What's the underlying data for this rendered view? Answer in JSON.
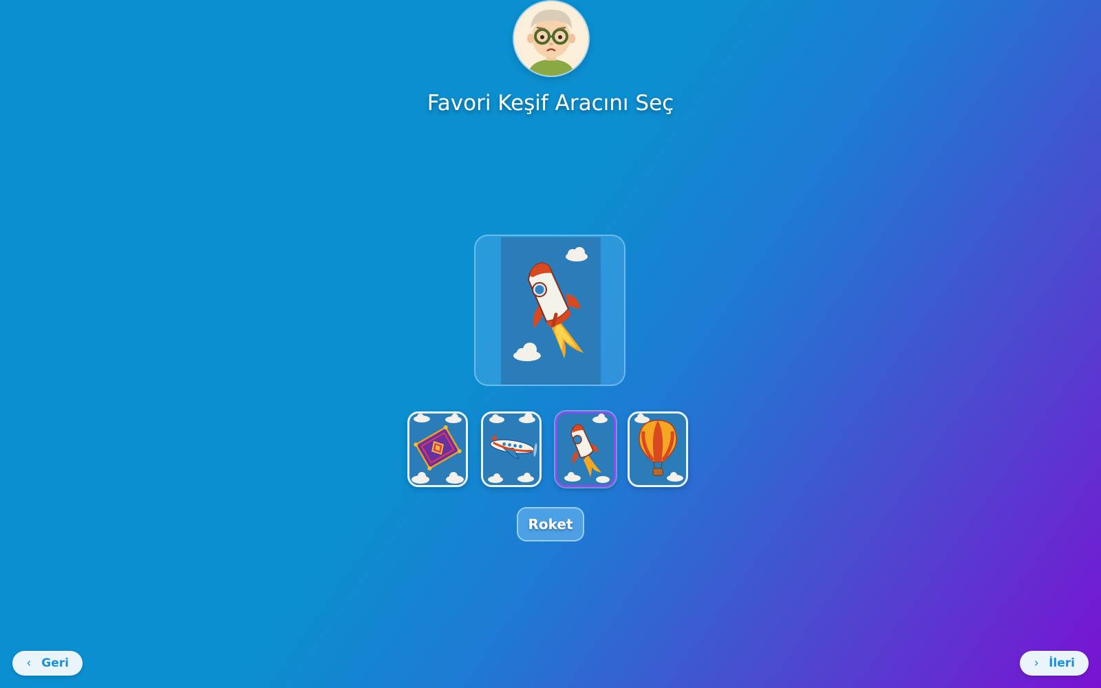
{
  "header": {
    "title": "Favori Keşif Aracını Seç"
  },
  "vehicles": [
    {
      "name": "magic-carpet",
      "icon": "carpet-icon",
      "selected": false
    },
    {
      "name": "airplane",
      "icon": "airplane-icon",
      "selected": false
    },
    {
      "name": "rocket",
      "icon": "rocket-icon",
      "selected": true
    },
    {
      "name": "hot-air-balloon",
      "icon": "balloon-icon",
      "selected": false
    }
  ],
  "selection": {
    "label": "Roket"
  },
  "nav": {
    "back_label": "Geri",
    "next_label": "İleri"
  },
  "colors": {
    "selected_border": "#8a4bf0",
    "button_text": "#1a8fd6"
  }
}
